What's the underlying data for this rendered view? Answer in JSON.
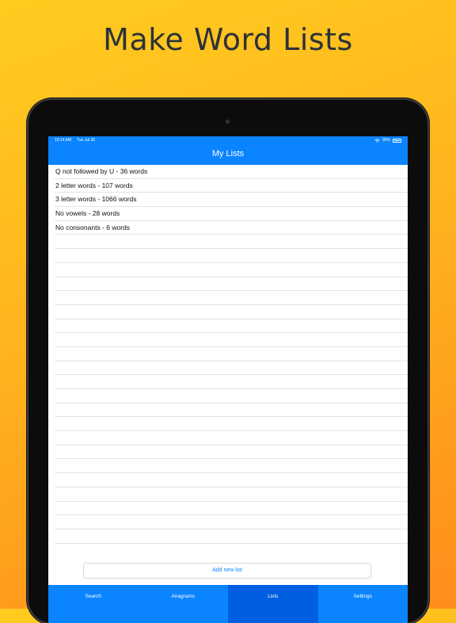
{
  "headline": "Make Word Lists",
  "status": {
    "time": "10:14 AM",
    "date": "Tue Jul 30",
    "battery": "95%"
  },
  "nav": {
    "title": "My Lists"
  },
  "lists": [
    "Q not followed by U - 36 words",
    "2 letter words - 107 words",
    "3 letter words - 1066 words",
    "No vowels - 28 words",
    "No consonants - 6 words"
  ],
  "empty_rows": 22,
  "add_button": "Add new list",
  "tabs": [
    {
      "label": "Search"
    },
    {
      "label": "Anagrams"
    },
    {
      "label": "Lists",
      "active": true
    },
    {
      "label": "Settings"
    }
  ],
  "colors": {
    "accent": "#0a84ff",
    "active_tab": "#005fe0",
    "background": "#ffb41e"
  }
}
